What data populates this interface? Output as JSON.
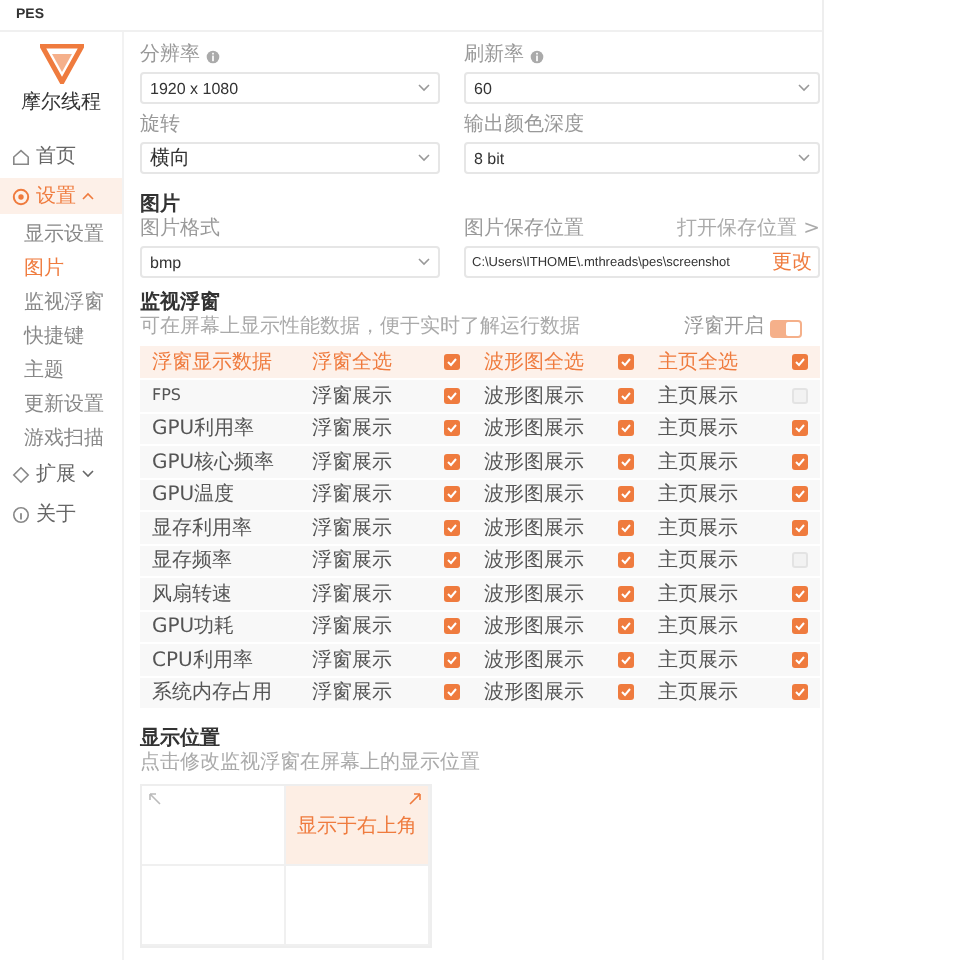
{
  "window": {
    "title": "PES"
  },
  "logo": {
    "text": "摩尔线程"
  },
  "sidebar": {
    "items": [
      {
        "label": "首页",
        "selected": false
      },
      {
        "label": "设置",
        "expanded": true,
        "selected": true,
        "children": [
          {
            "label": "显示设置",
            "selected": false
          },
          {
            "label": "图片",
            "selected": true
          },
          {
            "label": "监视浮窗",
            "selected": false
          },
          {
            "label": "快捷键",
            "selected": false
          },
          {
            "label": "主题",
            "selected": false
          },
          {
            "label": "更新设置",
            "selected": false
          },
          {
            "label": "游戏扫描",
            "selected": false
          }
        ]
      },
      {
        "label": "扩展",
        "expanded": false,
        "selected": false
      },
      {
        "label": "关于",
        "selected": false
      }
    ]
  },
  "display": {
    "fields": [
      {
        "label": "分辨率",
        "info": true,
        "value": "1920 x 1080"
      },
      {
        "label": "刷新率",
        "info": true,
        "value": "60"
      },
      {
        "label": "旋转",
        "info": false,
        "value": "横向"
      },
      {
        "label": "输出颜色深度",
        "info": false,
        "value": "8 bit"
      }
    ]
  },
  "picture": {
    "title": "图片",
    "format": {
      "label": "图片格式",
      "value": "bmp"
    },
    "location": {
      "label": "图片保存位置",
      "link": "打开保存位置 >",
      "value": "C:\\Users\\ITHOME\\.mthreads\\pes\\screenshot",
      "button": "更改"
    }
  },
  "monitor": {
    "title": "监视浮窗",
    "description": "可在屏幕上显示性能数据，便于实时了解运行数据",
    "toggle": {
      "label": "浮窗开启",
      "on": true
    },
    "header": {
      "label": "浮窗显示数据",
      "columns": [
        {
          "label": "浮窗全选",
          "checked": true
        },
        {
          "label": "波形图全选",
          "checked": true
        },
        {
          "label": "主页全选",
          "checked": true
        }
      ]
    },
    "rows": [
      {
        "name": "FPS",
        "cells": [
          {
            "label": "浮窗展示",
            "checked": true
          },
          {
            "label": "波形图展示",
            "checked": true
          },
          {
            "label": "主页展示",
            "checked": false
          }
        ]
      },
      {
        "name": "GPU利用率",
        "cells": [
          {
            "label": "浮窗展示",
            "checked": true
          },
          {
            "label": "波形图展示",
            "checked": true
          },
          {
            "label": "主页展示",
            "checked": true
          }
        ]
      },
      {
        "name": "GPU核心频率",
        "cells": [
          {
            "label": "浮窗展示",
            "checked": true
          },
          {
            "label": "波形图展示",
            "checked": true
          },
          {
            "label": "主页展示",
            "checked": true
          }
        ]
      },
      {
        "name": "GPU温度",
        "cells": [
          {
            "label": "浮窗展示",
            "checked": true
          },
          {
            "label": "波形图展示",
            "checked": true
          },
          {
            "label": "主页展示",
            "checked": true
          }
        ]
      },
      {
        "name": "显存利用率",
        "cells": [
          {
            "label": "浮窗展示",
            "checked": true
          },
          {
            "label": "波形图展示",
            "checked": true
          },
          {
            "label": "主页展示",
            "checked": true
          }
        ]
      },
      {
        "name": "显存频率",
        "cells": [
          {
            "label": "浮窗展示",
            "checked": true
          },
          {
            "label": "波形图展示",
            "checked": true
          },
          {
            "label": "主页展示",
            "checked": false
          }
        ]
      },
      {
        "name": "风扇转速",
        "cells": [
          {
            "label": "浮窗展示",
            "checked": true
          },
          {
            "label": "波形图展示",
            "checked": true
          },
          {
            "label": "主页展示",
            "checked": true
          }
        ]
      },
      {
        "name": "GPU功耗",
        "cells": [
          {
            "label": "浮窗展示",
            "checked": true
          },
          {
            "label": "波形图展示",
            "checked": true
          },
          {
            "label": "主页展示",
            "checked": true
          }
        ]
      },
      {
        "name": "CPU利用率",
        "cells": [
          {
            "label": "浮窗展示",
            "checked": true
          },
          {
            "label": "波形图展示",
            "checked": true
          },
          {
            "label": "主页展示",
            "checked": true
          }
        ]
      },
      {
        "name": "系统内存占用",
        "cells": [
          {
            "label": "浮窗展示",
            "checked": true
          },
          {
            "label": "波形图展示",
            "checked": true
          },
          {
            "label": "主页展示",
            "checked": true
          }
        ]
      }
    ]
  },
  "position": {
    "title": "显示位置",
    "description": "点击修改监视浮窗在屏幕上的显示位置",
    "cells": [
      {
        "selected": false
      },
      {
        "selected": true,
        "label": "显示于右上角"
      },
      {
        "selected": false
      },
      {
        "selected": false
      }
    ]
  }
}
